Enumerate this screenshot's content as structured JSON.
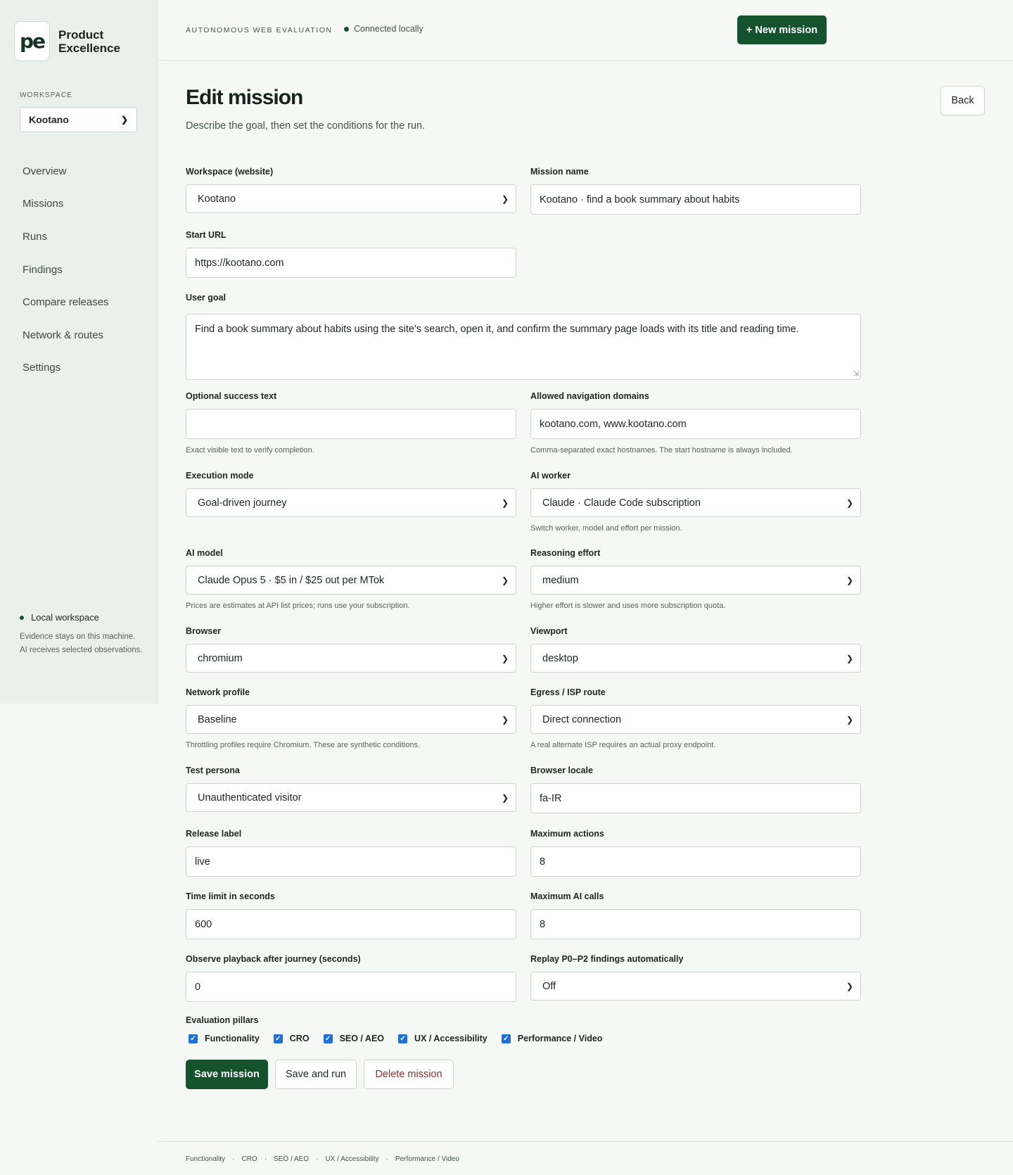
{
  "brand": {
    "logo": "pe",
    "name": "Product Excellence"
  },
  "sidebar": {
    "workspace_label": "WORKSPACE",
    "workspace_value": "Kootano",
    "nav": [
      {
        "label": "Overview"
      },
      {
        "label": "Missions"
      },
      {
        "label": "Runs"
      },
      {
        "label": "Findings"
      },
      {
        "label": "Compare releases"
      },
      {
        "label": "Network & routes"
      },
      {
        "label": "Settings"
      }
    ],
    "local": {
      "title": "Local workspace",
      "line1": "Evidence stays on this machine.",
      "line2": "AI receives selected observations."
    }
  },
  "topbar": {
    "label": "AUTONOMOUS WEB EVALUATION",
    "status": "Connected locally",
    "new_button": "+ New mission"
  },
  "page": {
    "title": "Edit mission",
    "subtitle": "Describe the goal, then set the conditions for the run.",
    "back_button": "Back"
  },
  "form": {
    "workspace": {
      "label": "Workspace (website)",
      "value": "Kootano"
    },
    "mission_name": {
      "label": "Mission name",
      "value": "Kootano · find a book summary about habits"
    },
    "start_url": {
      "label": "Start URL",
      "value": "https://kootano.com"
    },
    "user_goal": {
      "label": "User goal",
      "value": "Find a book summary about habits using the site's search, open it, and confirm the summary page loads with its title and reading time."
    },
    "success_text": {
      "label": "Optional success text",
      "value": "",
      "help": "Exact visible text to verify completion."
    },
    "allowed_domains": {
      "label": "Allowed navigation domains",
      "value": "kootano.com, www.kootano.com",
      "help": "Comma-separated exact hostnames. The start hostname is always included."
    },
    "execution_mode": {
      "label": "Execution mode",
      "value": "Goal-driven journey"
    },
    "ai_worker": {
      "label": "AI worker",
      "value": "Claude · Claude Code subscription",
      "help": "Switch worker, model and effort per mission."
    },
    "ai_model": {
      "label": "AI model",
      "value": "Claude Opus 5 · $5 in / $25 out per MTok",
      "help": "Prices are estimates at API list prices; runs use your subscription."
    },
    "reasoning_effort": {
      "label": "Reasoning effort",
      "value": "medium",
      "help": "Higher effort is slower and uses more subscription quota."
    },
    "browser": {
      "label": "Browser",
      "value": "chromium"
    },
    "viewport": {
      "label": "Viewport",
      "value": "desktop"
    },
    "network_profile": {
      "label": "Network profile",
      "value": "Baseline",
      "help": "Throttling profiles require Chromium. These are synthetic conditions."
    },
    "egress": {
      "label": "Egress / ISP route",
      "value": "Direct connection",
      "help": "A real alternate ISP requires an actual proxy endpoint."
    },
    "persona": {
      "label": "Test persona",
      "value": "Unauthenticated visitor"
    },
    "locale": {
      "label": "Browser locale",
      "value": "fa-IR"
    },
    "release_label": {
      "label": "Release label",
      "value": "live"
    },
    "max_actions": {
      "label": "Maximum actions",
      "value": "8"
    },
    "time_limit": {
      "label": "Time limit in seconds",
      "value": "600"
    },
    "max_ai_calls": {
      "label": "Maximum AI calls",
      "value": "8"
    },
    "observe_playback": {
      "label": "Observe playback after journey (seconds)",
      "value": "0"
    },
    "replay_findings": {
      "label": "Replay P0–P2 findings automatically",
      "value": "Off"
    },
    "pillars_label": "Evaluation pillars",
    "pillars": [
      {
        "label": "Functionality",
        "checked": true
      },
      {
        "label": "CRO",
        "checked": true
      },
      {
        "label": "SEO / AEO",
        "checked": true
      },
      {
        "label": "UX / Accessibility",
        "checked": true
      },
      {
        "label": "Performance / Video",
        "checked": true
      }
    ],
    "save_button": "Save mission",
    "save_run_button": "Save and run",
    "delete_button": "Delete mission"
  },
  "footer": {
    "links": [
      "Functionality",
      "CRO",
      "SEO / AEO",
      "UX / Accessibility",
      "Performance / Video"
    ],
    "separator": "·"
  },
  "colors": {
    "accent": "#14532d",
    "delete": "#8a2f2f",
    "checkbox": "#1f6fd8"
  }
}
